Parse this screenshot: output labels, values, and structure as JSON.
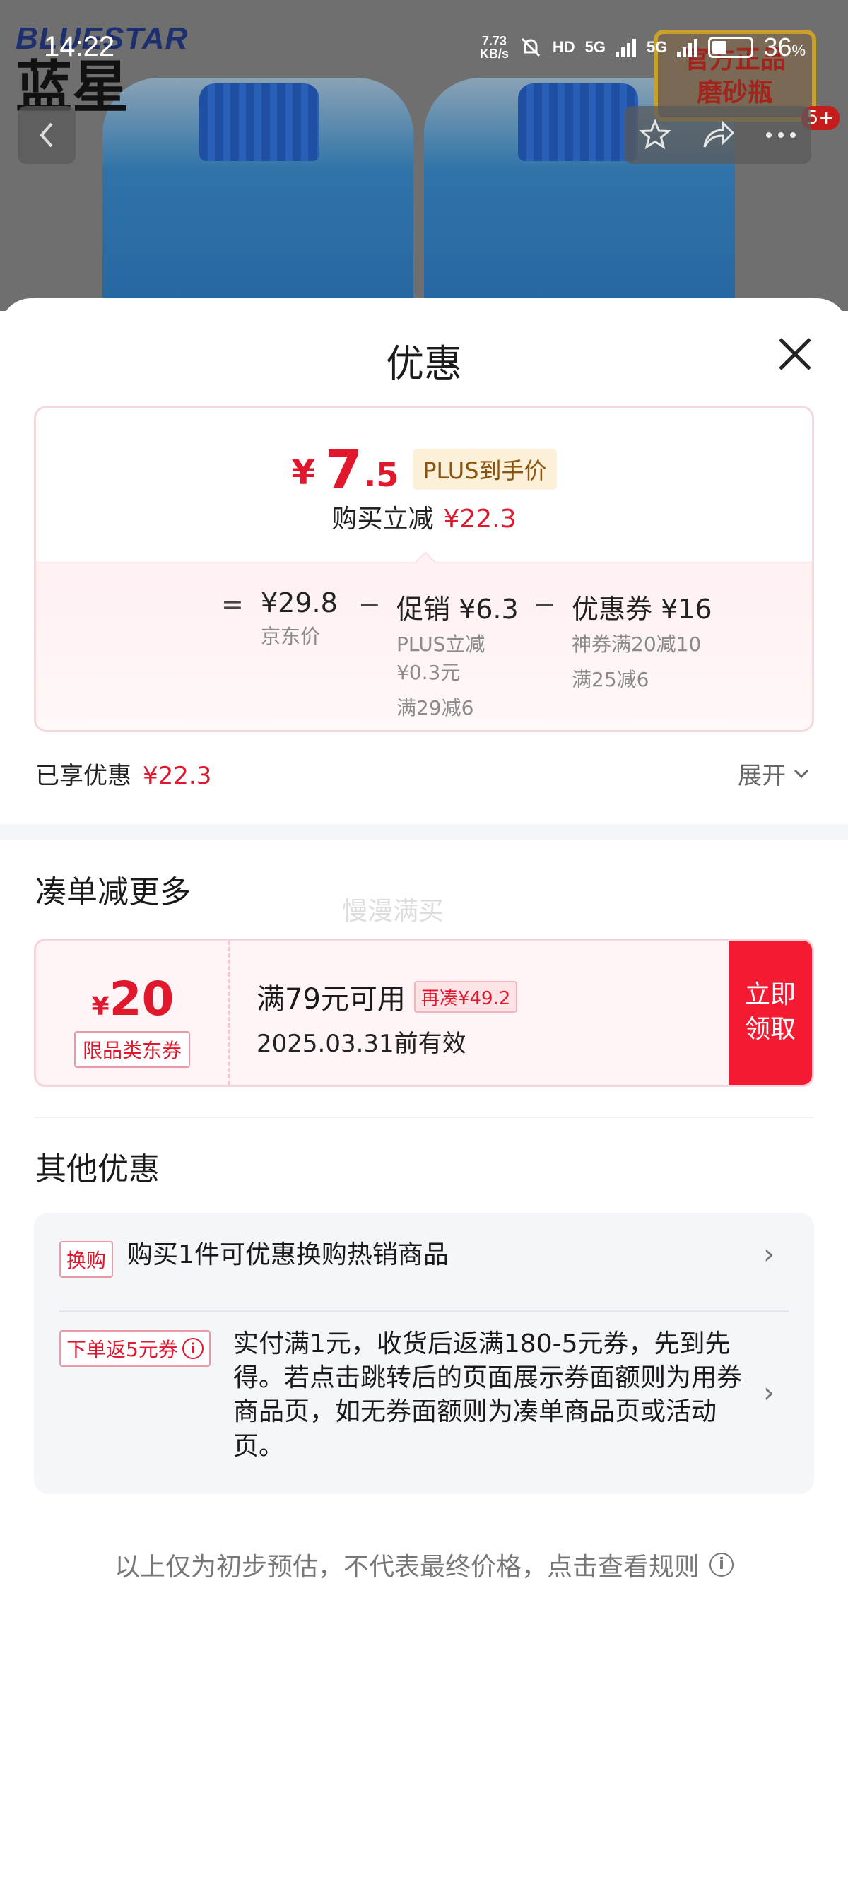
{
  "status_bar": {
    "time": "14:22",
    "net_speed": "7.73",
    "net_unit": "KB/s",
    "hd": "HD",
    "signal1": "5G",
    "signal2": "5G",
    "battery_pct": "36",
    "battery_unit": "%"
  },
  "background": {
    "brand_en": "BLUESTAR",
    "brand_cn": "蓝星",
    "badge_line1": "官方正品",
    "badge_line2": "磨砂瓶",
    "cart_count": "5+"
  },
  "sheet": {
    "title": "优惠"
  },
  "price_card": {
    "currency": "¥",
    "final_int": "7",
    "final_dec": ".5",
    "plus_tag": "PLUS到手价",
    "saved_label": "购买立减",
    "saved_value": "¥22.3",
    "equals": "=",
    "minus": "−",
    "jd_price": "¥29.8",
    "jd_label": "京东价",
    "promo_head": "促销 ¥6.3",
    "promo_sub1": "PLUS立减",
    "promo_sub2": "¥0.3元",
    "promo_sub3": "满29减6",
    "coupon_head": "优惠券 ¥16",
    "coupon_sub1": "神券满20减10",
    "coupon_sub2": "满25减6"
  },
  "enjoyed": {
    "label": "已享优惠",
    "value": "¥22.3",
    "expand": "展开"
  },
  "more_section": {
    "title": "凑单减更多",
    "watermark": "慢漫满买"
  },
  "coupon": {
    "currency": "¥",
    "amount": "20",
    "category": "限品类东券",
    "condition": "满79元可用",
    "more_needed": "再凑¥49.2",
    "expiry": "2025.03.31前有效",
    "button_line1": "立即",
    "button_line2": "领取"
  },
  "other_section": {
    "title": "其他优惠",
    "offers": [
      {
        "tag": "换购",
        "text": "购买1件可优惠换购热销商品"
      },
      {
        "tag": "下单返5元券",
        "text": "实付满1元，收货后返满180-5元券，先到先得。若点击跳转后的页面展示券面额则为用券商品页，如无券面额则为凑单商品页或活动页。"
      }
    ]
  },
  "footnote": "以上仅为初步预估，不代表最终价格，点击查看规则",
  "colors": {
    "accent_red": "#e1172e",
    "button_red": "#f31a32",
    "plus_tag_bg": "#fdf0d8"
  }
}
